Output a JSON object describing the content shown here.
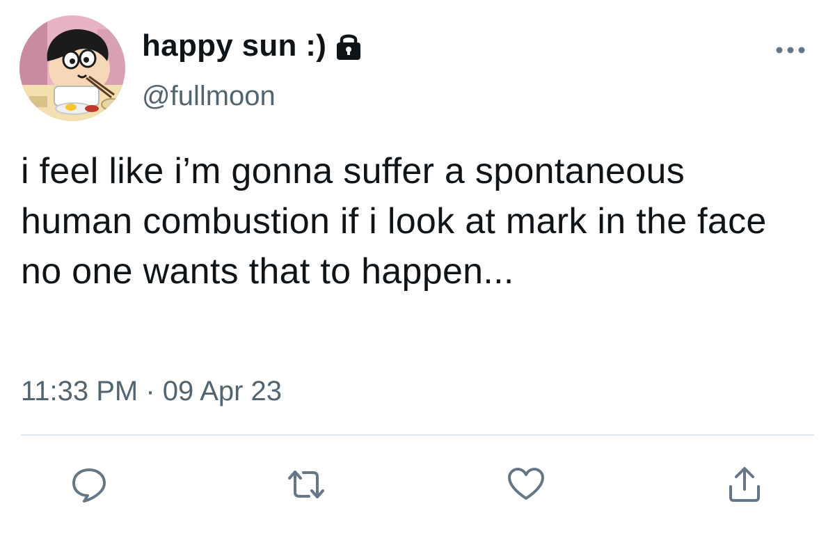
{
  "tweet": {
    "display_name": "happy sun :)",
    "handle": "@fullmoon",
    "text": "i feel like i’m gonna suffer a spontaneous human combustion if i look at mark in the face no one wants that to happen...",
    "timestamp": "11:33 PM · 09 Apr 23",
    "protected": true
  },
  "icons": {
    "lock": "lock-icon",
    "more": "more-horizontal-icon",
    "reply": "reply-icon",
    "retweet": "retweet-icon",
    "like": "heart-icon",
    "share": "share-icon"
  },
  "colors": {
    "text_primary": "#0f1419",
    "text_secondary": "#536471",
    "icon_gray": "#657786",
    "divider": "#e1e8ed"
  }
}
